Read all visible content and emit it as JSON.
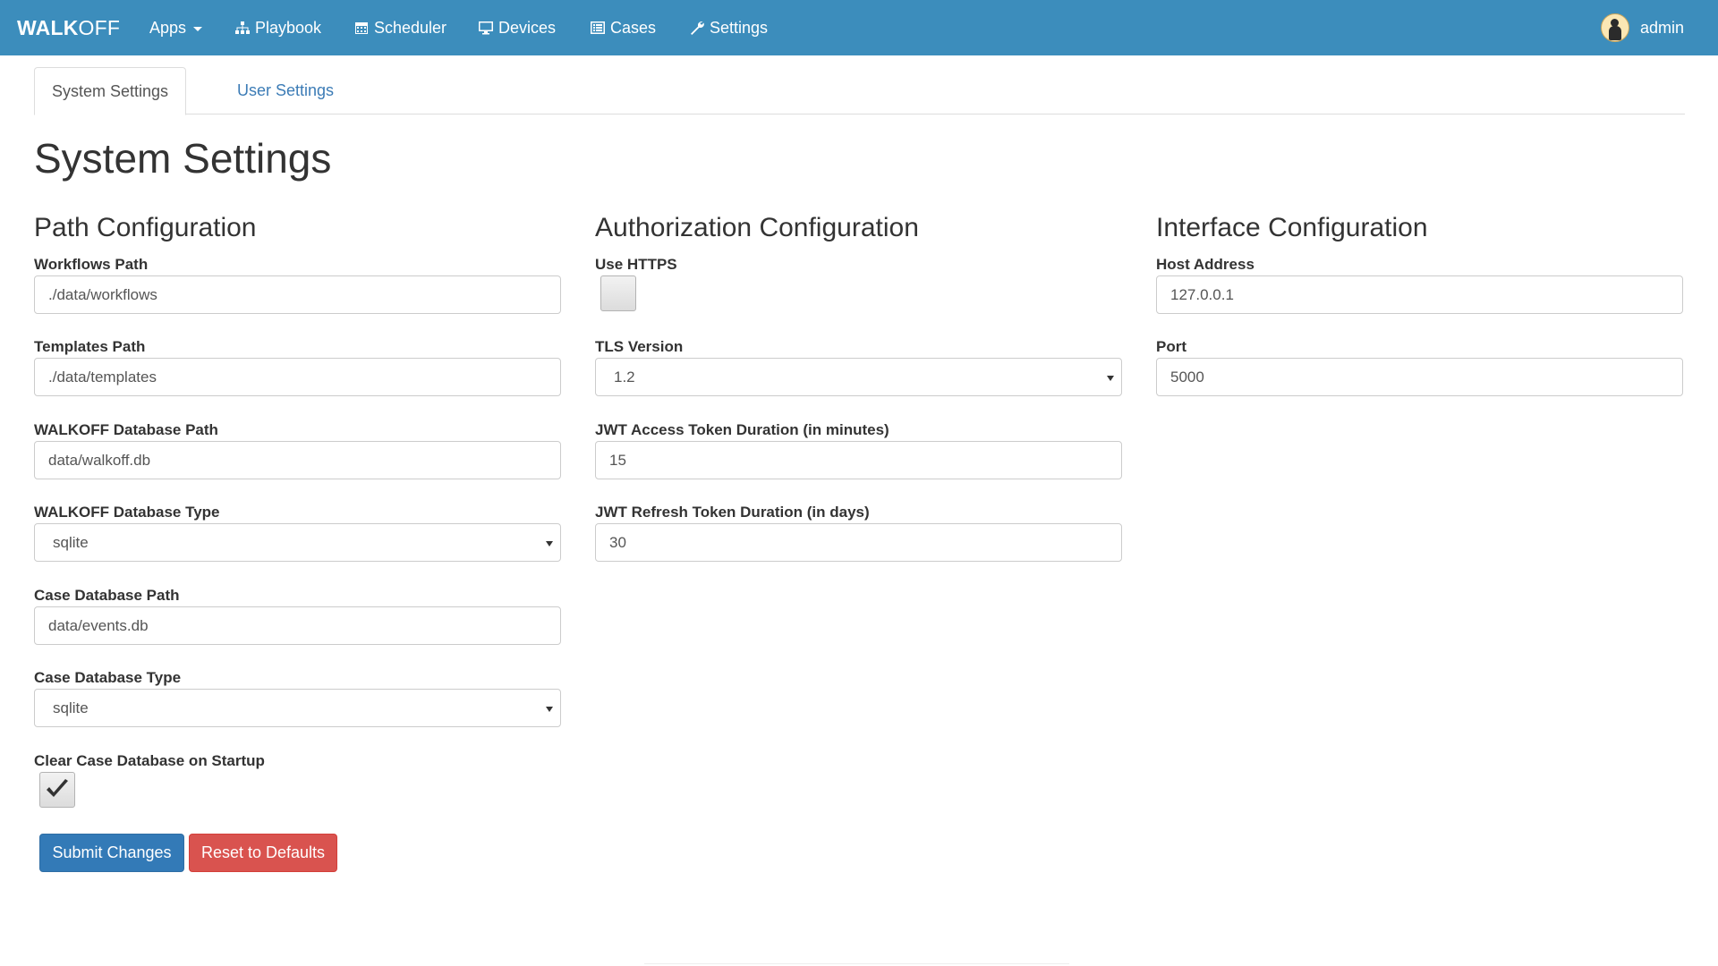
{
  "navbar": {
    "brand_part1": "WALK",
    "brand_part2": "OFF",
    "items": [
      {
        "label": "Apps",
        "icon": "none",
        "has_caret": true
      },
      {
        "label": "Playbook",
        "icon": "sitemap-icon"
      },
      {
        "label": "Scheduler",
        "icon": "calendar-icon"
      },
      {
        "label": "Devices",
        "icon": "desktop-icon"
      },
      {
        "label": "Cases",
        "icon": "list-alt-icon"
      },
      {
        "label": "Settings",
        "icon": "wrench-icon"
      }
    ],
    "user": {
      "name": "admin",
      "icon": "avatar-icon"
    },
    "color": "#3c8dbc"
  },
  "tabs": [
    {
      "label": "System Settings",
      "active": true
    },
    {
      "label": "User Settings",
      "active": false
    }
  ],
  "page_title": "System Settings",
  "path_config": {
    "title": "Path Configuration",
    "workflows_path": {
      "label": "Workflows Path",
      "value": "./data/workflows"
    },
    "templates_path": {
      "label": "Templates Path",
      "value": "./data/templates"
    },
    "db_path": {
      "label": "WALKOFF Database Path",
      "value": "data/walkoff.db"
    },
    "db_type": {
      "label": "WALKOFF Database Type",
      "value": "sqlite"
    },
    "case_db_path": {
      "label": "Case Database Path",
      "value": "data/events.db"
    },
    "case_db_type": {
      "label": "Case Database Type",
      "value": "sqlite"
    },
    "clear_case_db": {
      "label": "Clear Case Database on Startup",
      "checked": true
    }
  },
  "auth_config": {
    "title": "Authorization Configuration",
    "use_https": {
      "label": "Use HTTPS",
      "checked": false
    },
    "tls_version": {
      "label": "TLS Version",
      "value": "1.2"
    },
    "jwt_access": {
      "label": "JWT Access Token Duration (in minutes)",
      "value": "15"
    },
    "jwt_refresh": {
      "label": "JWT Refresh Token Duration (in days)",
      "value": "30"
    }
  },
  "interface_config": {
    "title": "Interface Configuration",
    "host": {
      "label": "Host Address",
      "value": "127.0.0.1"
    },
    "port": {
      "label": "Port",
      "value": "5000"
    }
  },
  "buttons": {
    "submit": "Submit Changes",
    "reset": "Reset to Defaults"
  },
  "colors": {
    "primary": "#337ab7",
    "danger": "#d9534f",
    "link": "#3c7cb6"
  }
}
